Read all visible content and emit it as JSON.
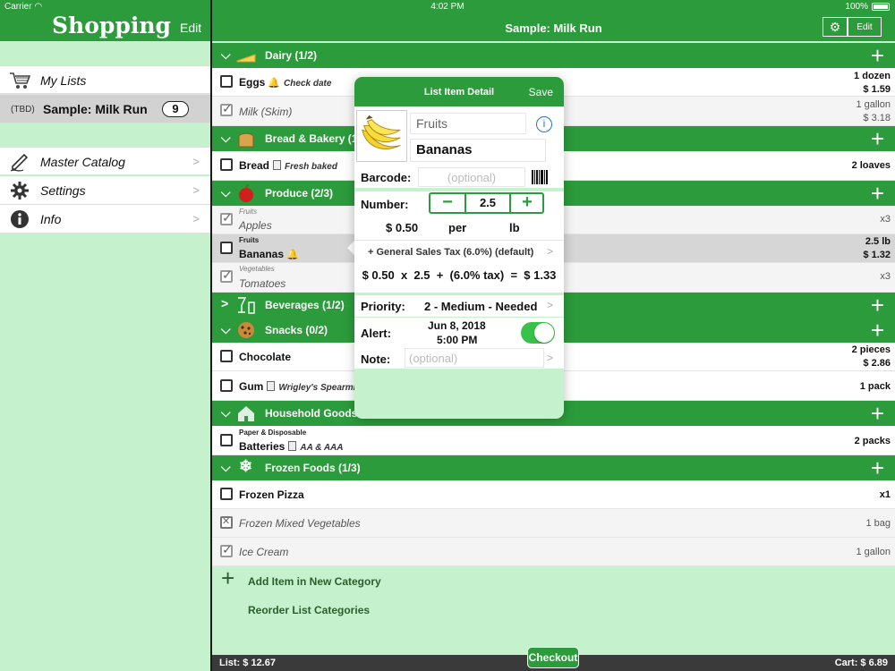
{
  "status": {
    "carrier": "Carrier",
    "time": "4:02 PM",
    "battery": "100%"
  },
  "sidebar": {
    "title": "Shopping",
    "edit_label": "Edit",
    "my_lists": "My Lists",
    "current_list": {
      "tag": "(TBD)",
      "name": "Sample: Milk Run",
      "count": "9"
    },
    "items": [
      {
        "label": "Master Catalog",
        "icon": "pen-icon"
      },
      {
        "label": "Settings",
        "icon": "gear-icon"
      },
      {
        "label": "Info",
        "icon": "info-icon"
      }
    ]
  },
  "main": {
    "title": "Sample: Milk Run",
    "edit_label": "Edit",
    "categories": {
      "dairy": "Dairy (1/2)",
      "bread": "Bread & Bakery (1/1)",
      "produce": "Produce (2/3)",
      "beverages": "Beverages (1/2)",
      "snacks": "Snacks (0/2)",
      "household": "Household Goods",
      "frozen": "Frozen Foods (1/3)"
    },
    "items": {
      "eggs": {
        "name": "Eggs",
        "note": "Check date",
        "qty": "1 dozen",
        "price": "$ 1.59"
      },
      "milk": {
        "name": "Milk (Skim)",
        "qty": "1 gallon",
        "price": "$ 3.18"
      },
      "bread": {
        "name": "Bread",
        "note": "Fresh baked",
        "qty": "2 loaves"
      },
      "apples": {
        "sub": "Fruits",
        "name": "Apples",
        "qty": "x3"
      },
      "bananas": {
        "sub": "Fruits",
        "name": "Bananas",
        "qty": "2.5 lb",
        "price": "$ 1.32"
      },
      "tomatoes": {
        "sub": "Vegetables",
        "name": "Tomatoes",
        "qty": "x3"
      },
      "chocolate": {
        "name": "Chocolate",
        "qty": "2 pieces",
        "price": "$ 2.86"
      },
      "gum": {
        "name": "Gum",
        "note": "Wrigley's Spearmint",
        "qty": "1 pack"
      },
      "batteries": {
        "sub": "Paper & Disposable",
        "name": "Batteries",
        "note": "AA & AAA",
        "qty": "2 packs"
      },
      "pizza": {
        "name": "Frozen Pizza",
        "qty": "x1"
      },
      "mixed_veg": {
        "name": "Frozen Mixed Vegetables",
        "qty": "1 bag"
      },
      "ice_cream": {
        "name": "Ice Cream",
        "qty": "1 gallon"
      }
    },
    "add_item": "Add Item in New Category",
    "reorder": "Reorder List Categories"
  },
  "footer": {
    "list_total": "List: $ 12.67",
    "checkout": "Checkout",
    "cart_total": "Cart: $ 6.89"
  },
  "detail": {
    "title": "List Item Detail",
    "save": "Save",
    "category": "Fruits",
    "name": "Bananas",
    "barcode_label": "Barcode:",
    "barcode_placeholder": "(optional)",
    "number_label": "Number:",
    "number_value": "2.5",
    "unit_price": "$ 0.50",
    "per": "per",
    "unit": "lb",
    "tax": "+ General Sales Tax (6.0%) (default)",
    "formula": "$ 0.50  x  2.5  +  (6.0% tax)  =  $ 1.33",
    "priority_label": "Priority:",
    "priority_value": "2 - Medium - Needed",
    "alert_label": "Alert:",
    "alert_date": "Jun 8, 2018",
    "alert_time": "5:00 PM",
    "alert_on": true,
    "note_label": "Note:",
    "note_placeholder": "(optional)"
  },
  "colors": {
    "accent": "#2c9b3c",
    "background": "#c5f2cc",
    "toggle": "#39c24a"
  }
}
